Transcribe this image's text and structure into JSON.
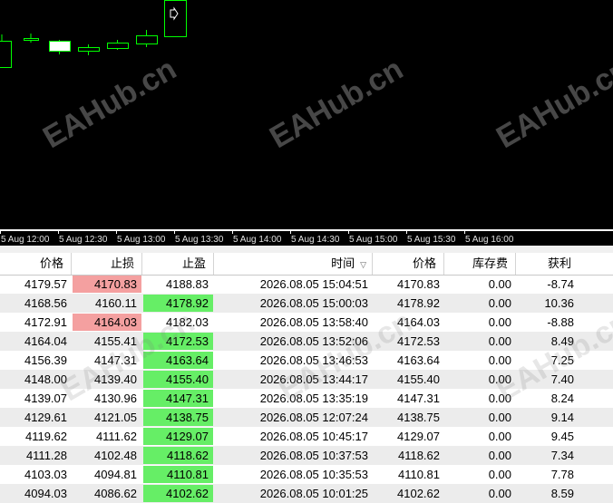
{
  "chart": {
    "colors": {
      "background": "#000000",
      "candle_border": "#00ff00",
      "bull_fill": "#000000",
      "bear_fill": "#ffffff"
    },
    "watermark": "EAHub.cn",
    "time_axis": [
      "5 Aug 12:00",
      "5 Aug 12:30",
      "5 Aug 13:00",
      "5 Aug 13:30",
      "5 Aug 14:00",
      "5 Aug 14:30",
      "5 Aug 15:00",
      "5 Aug 15:30",
      "5 Aug 16:00"
    ],
    "marker_icon": "buy-arrow-icon"
  },
  "table": {
    "columns": [
      "价格",
      "止损",
      "止盈",
      "时间",
      "价格",
      "库存费",
      "获利"
    ],
    "sort_indicator": "▽",
    "colors": {
      "sl_hit": "#f4a0a0",
      "tp_hit": "#66ee66",
      "row_alt": "#ececec",
      "row": "#ffffff"
    },
    "rows": [
      {
        "price_open": "4179.57",
        "sl": "4170.83",
        "tp": "4188.83",
        "time": "2026.08.05 15:04:51",
        "price_close": "4170.83",
        "swap": "0.00",
        "profit": "-8.74",
        "hit": "sl"
      },
      {
        "price_open": "4168.56",
        "sl": "4160.11",
        "tp": "4178.92",
        "time": "2026.08.05 15:00:03",
        "price_close": "4178.92",
        "swap": "0.00",
        "profit": "10.36",
        "hit": "tp"
      },
      {
        "price_open": "4172.91",
        "sl": "4164.03",
        "tp": "4182.03",
        "time": "2026.08.05 13:58:40",
        "price_close": "4164.03",
        "swap": "0.00",
        "profit": "-8.88",
        "hit": "sl"
      },
      {
        "price_open": "4164.04",
        "sl": "4155.41",
        "tp": "4172.53",
        "time": "2026.08.05 13:52:06",
        "price_close": "4172.53",
        "swap": "0.00",
        "profit": "8.49",
        "hit": "tp"
      },
      {
        "price_open": "4156.39",
        "sl": "4147.31",
        "tp": "4163.64",
        "time": "2026.08.05 13:46:53",
        "price_close": "4163.64",
        "swap": "0.00",
        "profit": "7.25",
        "hit": "tp"
      },
      {
        "price_open": "4148.00",
        "sl": "4139.40",
        "tp": "4155.40",
        "time": "2026.08.05 13:44:17",
        "price_close": "4155.40",
        "swap": "0.00",
        "profit": "7.40",
        "hit": "tp"
      },
      {
        "price_open": "4139.07",
        "sl": "4130.96",
        "tp": "4147.31",
        "time": "2026.08.05 13:35:19",
        "price_close": "4147.31",
        "swap": "0.00",
        "profit": "8.24",
        "hit": "tp"
      },
      {
        "price_open": "4129.61",
        "sl": "4121.05",
        "tp": "4138.75",
        "time": "2026.08.05 12:07:24",
        "price_close": "4138.75",
        "swap": "0.00",
        "profit": "9.14",
        "hit": "tp"
      },
      {
        "price_open": "4119.62",
        "sl": "4111.62",
        "tp": "4129.07",
        "time": "2026.08.05 10:45:17",
        "price_close": "4129.07",
        "swap": "0.00",
        "profit": "9.45",
        "hit": "tp"
      },
      {
        "price_open": "4111.28",
        "sl": "4102.48",
        "tp": "4118.62",
        "time": "2026.08.05 10:37:53",
        "price_close": "4118.62",
        "swap": "0.00",
        "profit": "7.34",
        "hit": "tp"
      },
      {
        "price_open": "4103.03",
        "sl": "4094.81",
        "tp": "4110.81",
        "time": "2026.08.05 10:35:53",
        "price_close": "4110.81",
        "swap": "0.00",
        "profit": "7.78",
        "hit": "tp"
      },
      {
        "price_open": "4094.03",
        "sl": "4086.62",
        "tp": "4102.62",
        "time": "2026.08.05 10:01:25",
        "price_close": "4102.62",
        "swap": "0.00",
        "profit": "8.59",
        "hit": "tp"
      }
    ]
  }
}
